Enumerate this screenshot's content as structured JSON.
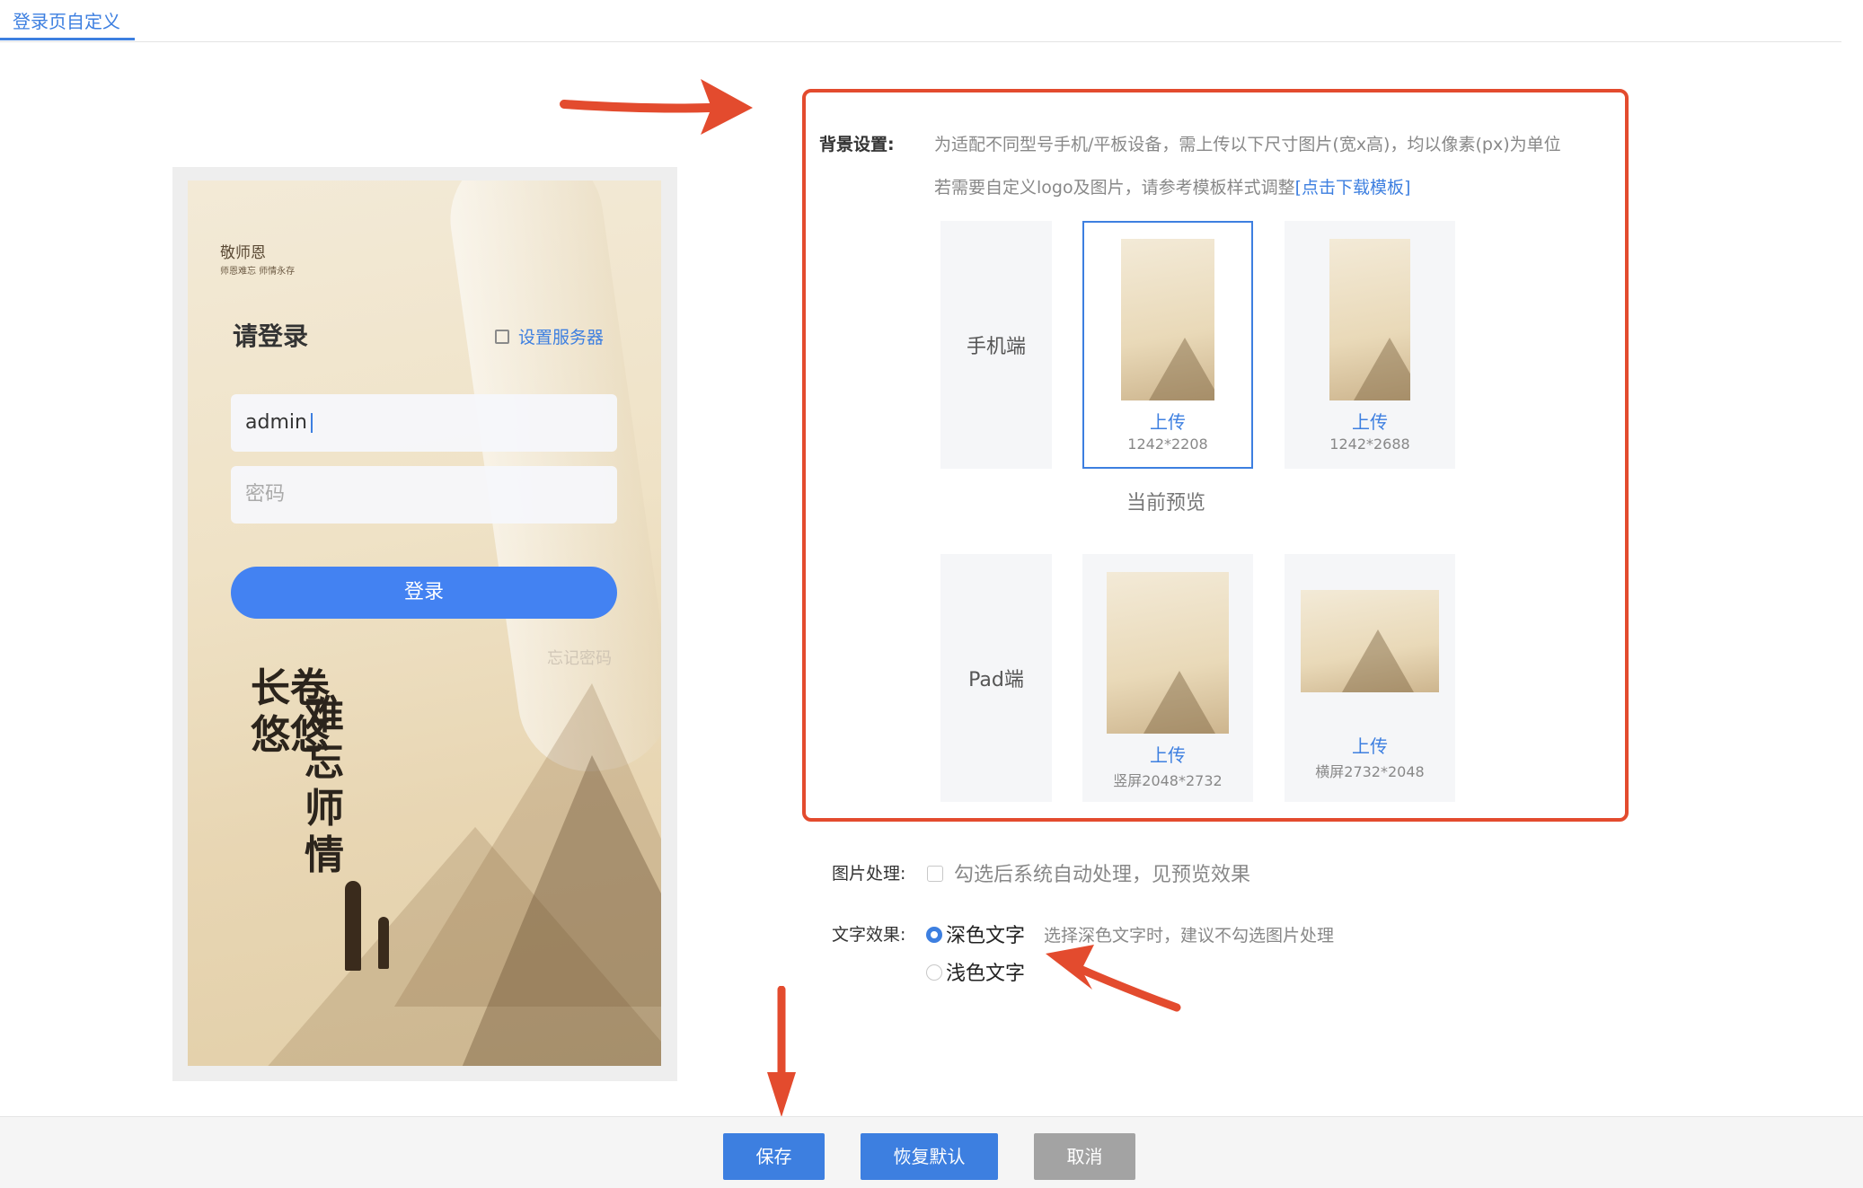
{
  "tab": {
    "label": "登录页自定义"
  },
  "preview": {
    "brand": "敬师恩",
    "brand_sub": "师恩难忘 师情永存",
    "title": "请登录",
    "server_link": "设置服务器",
    "username_value": "admin",
    "password_placeholder": "密码",
    "login_button": "登录",
    "forgot_password": "忘记密码",
    "calligraphy_left": "长卷悠悠",
    "calligraphy_right": "难忘师情"
  },
  "background": {
    "label": "背景设置:",
    "desc_line1": "为适配不同型号手机/平板设备，需上传以下尺寸图片(宽x高)，均以像素(px)为单位",
    "desc_line2_prefix": "若需要自定义logo及图片，请参考模板样式调整",
    "template_link": "[点击下载模板]",
    "phone_row": {
      "label": "手机端",
      "cards": [
        {
          "upload": "上传",
          "size": "1242*2208",
          "selected": true
        },
        {
          "upload": "上传",
          "size": "1242*2688",
          "selected": false
        }
      ]
    },
    "current_preview": "当前预览",
    "pad_row": {
      "label": "Pad端",
      "cards": [
        {
          "upload": "上传",
          "size": "竖屏2048*2732",
          "selected": false
        },
        {
          "upload": "上传",
          "size": "横屏2732*2048",
          "selected": false
        }
      ]
    }
  },
  "image_processing": {
    "label": "图片处理:",
    "checkbox_text": "勾选后系统自动处理，见预览效果",
    "checked": false
  },
  "text_effect": {
    "label": "文字效果:",
    "dark_option": "深色文字",
    "dark_hint": "选择深色文字时，建议不勾选图片处理",
    "light_option": "浅色文字",
    "selected": "dark"
  },
  "footer": {
    "save": "保存",
    "restore": "恢复默认",
    "cancel": "取消"
  },
  "colors": {
    "accent": "#3d7fe0",
    "annotation_red": "#e34b2e",
    "cancel_gray": "#a3a3a3"
  }
}
